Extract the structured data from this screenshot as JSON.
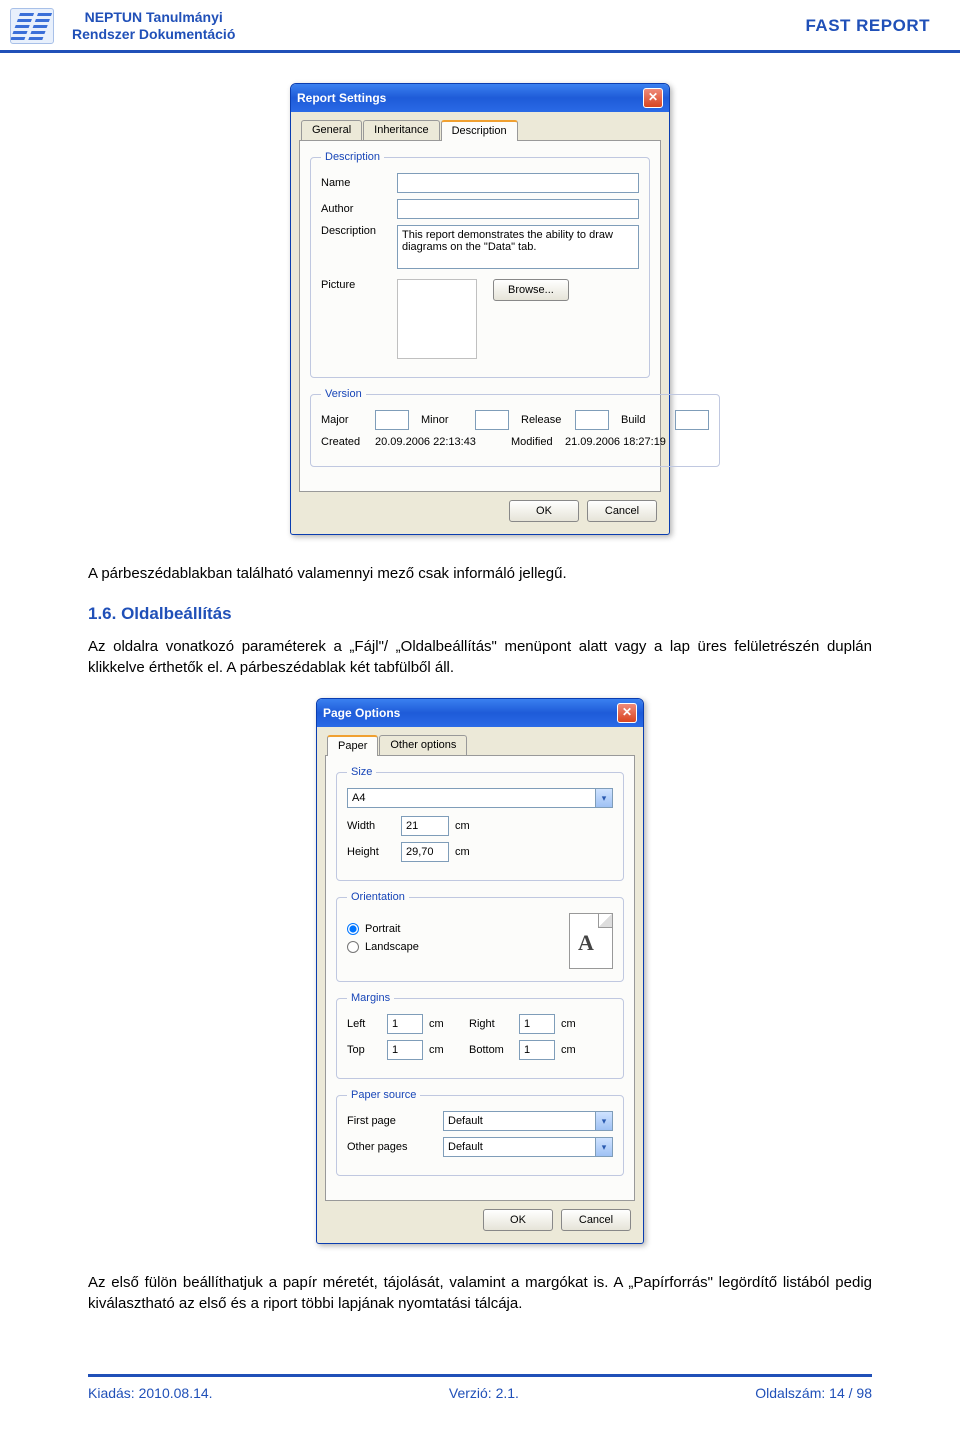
{
  "header": {
    "title_line1": "NEPTUN Tanulmányi",
    "title_line2": "Rendszer Dokumentáció",
    "right": "FAST REPORT"
  },
  "dialog1": {
    "title": "Report Settings",
    "tabs": {
      "general": "General",
      "inheritance": "Inheritance",
      "description": "Description"
    },
    "desc": {
      "legend": "Description",
      "name_label": "Name",
      "name_value": "",
      "author_label": "Author",
      "author_value": "",
      "desc_label": "Description",
      "desc_value": "This report demonstrates the ability to draw diagrams on the \"Data\" tab.",
      "picture_label": "Picture",
      "browse_btn": "Browse..."
    },
    "version": {
      "legend": "Version",
      "major": "Major",
      "minor": "Minor",
      "release": "Release",
      "build": "Build",
      "created_label": "Created",
      "created_value": "20.09.2006 22:13:43",
      "modified_label": "Modified",
      "modified_value": "21.09.2006 18:27:19"
    },
    "ok": "OK",
    "cancel": "Cancel"
  },
  "para1": "A párbeszédablakban található valamennyi mező csak informáló jellegű.",
  "heading": "1.6. Oldalbeállítás",
  "para2": "Az oldalra vonatkozó paraméterek a „Fájl\"/ „Oldalbeállítás\" menüpont alatt vagy a lap üres felületrészén duplán klikkelve érthetők el. A párbeszédablak két tabfülből áll.",
  "dialog2": {
    "title": "Page Options",
    "tabs": {
      "paper": "Paper",
      "other": "Other options"
    },
    "size": {
      "legend": "Size",
      "paper_value": "A4",
      "width_label": "Width",
      "width_value": "21",
      "height_label": "Height",
      "height_value": "29,70",
      "unit": "cm"
    },
    "orientation": {
      "legend": "Orientation",
      "portrait": "Portrait",
      "landscape": "Landscape",
      "glyph": "A"
    },
    "margins": {
      "legend": "Margins",
      "left_label": "Left",
      "left_value": "1",
      "right_label": "Right",
      "right_value": "1",
      "top_label": "Top",
      "top_value": "1",
      "bottom_label": "Bottom",
      "bottom_value": "1",
      "unit": "cm"
    },
    "source": {
      "legend": "Paper source",
      "first_label": "First page",
      "first_value": "Default",
      "other_label": "Other pages",
      "other_value": "Default"
    },
    "ok": "OK",
    "cancel": "Cancel"
  },
  "para3": "Az első fülön beállíthatjuk a papír méretét, tájolását, valamint a margókat is. A „Papírforrás\" legördítő listából pedig kiválasztható az első és a riport többi lapjának nyomtatási tálcája.",
  "footer": {
    "left": "Kiadás: 2010.08.14.",
    "center": "Verzió: 2.1.",
    "right": "Oldalszám: 14 / 98"
  }
}
